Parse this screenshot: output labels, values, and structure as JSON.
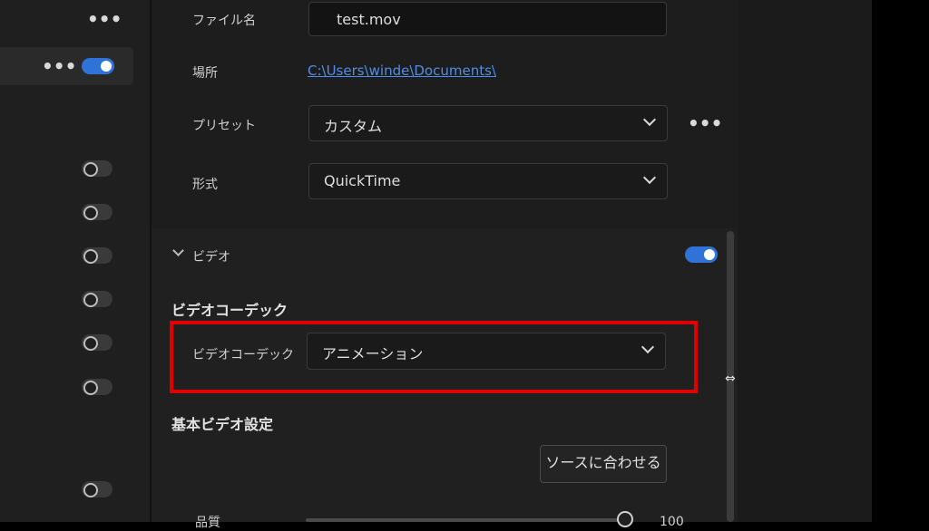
{
  "left_panel": {
    "row_more_label": "•••",
    "top_more_label": "•••"
  },
  "output": {
    "filename_label": "ファイル名",
    "filename_value": "test.mov",
    "location_label": "場所",
    "location_value": "C:\\Users\\winde\\Documents\\",
    "preset_label": "プリセット",
    "preset_value": "カスタム",
    "preset_more": "•••",
    "format_label": "形式",
    "format_value": "QuickTime"
  },
  "video": {
    "section_label": "ビデオ",
    "codec_heading": "ビデオコーデック",
    "codec_label": "ビデオコーデック",
    "codec_value": "アニメーション",
    "basic_heading": "基本ビデオ設定",
    "match_source_button": "ソースに合わせる",
    "quality_label": "品質",
    "quality_value": "100"
  },
  "colors": {
    "accent": "#2f72d8",
    "highlight": "#e10000",
    "link": "#4f8de6"
  }
}
